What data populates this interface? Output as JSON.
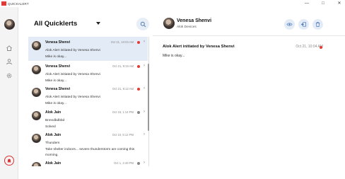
{
  "window": {
    "title": "QUICKALERT",
    "minimize": "—",
    "maximize": "□",
    "close": "✕"
  },
  "rail": {
    "icons": [
      "avatar",
      "home-icon",
      "user-icon",
      "gear-icon",
      "alert-bell-icon"
    ]
  },
  "list": {
    "title": "All Quicklerts",
    "items": [
      {
        "name": "Venesa Shenvi",
        "time": "Oct 21, 10:04 AM",
        "line1": "Alok Alert initiated by Venesa Shenvi",
        "line2": "Mike is okay...",
        "line3": "",
        "dot": "#e53935",
        "selected": true
      },
      {
        "name": "Venesa Shenvi",
        "time": "Oct 21, 9:19 AM",
        "line1": "Alok Alert initiated by Venesa Shenvi",
        "line2": "Mike is okay...",
        "line3": "",
        "dot": "#e53935",
        "selected": false
      },
      {
        "name": "Venesa Shenvi",
        "time": "Oct 21, 8:12 AM",
        "line1": "Alok Alert initiated by Venesa Shenvi",
        "line2": "Mike is okay...",
        "line3": "",
        "dot": "#e53935",
        "selected": false
      },
      {
        "name": "Alok Jain",
        "time": "Oct 18, 1:14 PM",
        "line1": "Bnnndbdbbd",
        "line2": "Solved",
        "line3": "",
        "dot": "#888888",
        "selected": false
      },
      {
        "name": "Alok Jain",
        "time": "Oct 10, 5:12 PM",
        "line1": "Thunders",
        "line2": "Take shelter indoors... severe thunderstorm are coming this",
        "line3": "morning.",
        "dot": "",
        "selected": false
      },
      {
        "name": "Alok Jain",
        "time": "Oct 1, 4:49 PM",
        "line1": "",
        "line2": "",
        "line3": "",
        "dot": "#888888",
        "selected": false
      }
    ]
  },
  "detail": {
    "name": "Venesa Shenvi",
    "subtitle": "Alok Devices",
    "message_title": "Alok Alert initiated by Venesa Shenvi",
    "time": "Oct 21, 10:04 AM",
    "body": "Mike is okay...",
    "status_color": "#e53935",
    "actions": [
      "eye-icon",
      "reply-icon",
      "trash-icon"
    ]
  },
  "colors": {
    "accent": "#4a79b8",
    "selected_row": "#e3ecf6",
    "unread_dot": "#e53935"
  }
}
